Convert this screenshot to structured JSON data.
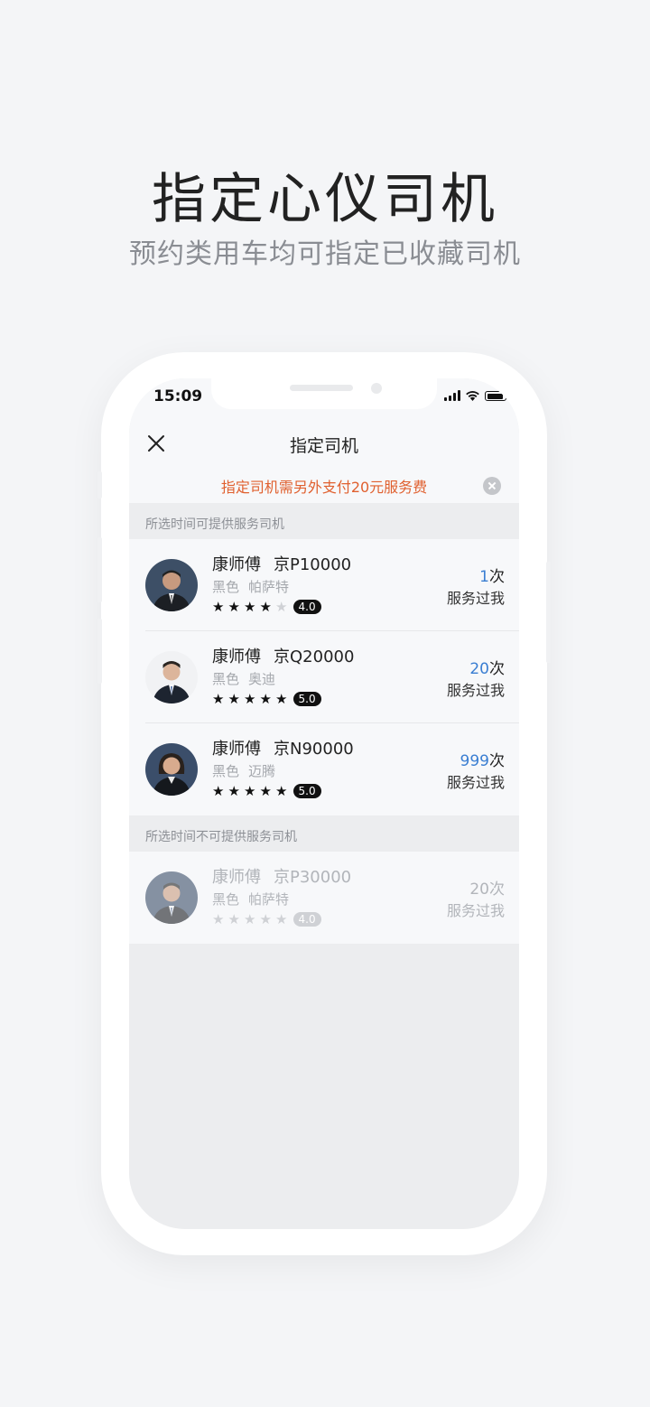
{
  "promo": {
    "title": "指定心仪司机",
    "subtitle": "预约类用车均可指定已收藏司机"
  },
  "status_bar": {
    "time": "15:09",
    "icons": [
      "signal-icon",
      "wifi-icon",
      "battery-icon"
    ]
  },
  "nav": {
    "title": "指定司机",
    "close_icon": "close-icon"
  },
  "notice": {
    "text": "指定司机需另外支付20元服务费",
    "close_icon": "close-circle-icon"
  },
  "sections": {
    "available_header": "所选时间可提供服务司机",
    "unavailable_header": "所选时间不可提供服务司机"
  },
  "drivers_available": [
    {
      "name": "康师傅",
      "plate": "京P10000",
      "color": "黑色",
      "model": "帕萨特",
      "stars": 4,
      "score": "4.0",
      "count": "1",
      "count_unit": "次",
      "served": "服务过我"
    },
    {
      "name": "康师傅",
      "plate": "京Q20000",
      "color": "黑色",
      "model": "奥迪",
      "stars": 5,
      "score": "5.0",
      "count": "20",
      "count_unit": "次",
      "served": "服务过我"
    },
    {
      "name": "康师傅",
      "plate": "京N90000",
      "color": "黑色",
      "model": "迈腾",
      "stars": 5,
      "score": "5.0",
      "count": "999",
      "count_unit": "次",
      "served": "服务过我"
    }
  ],
  "drivers_unavailable": [
    {
      "name": "康师傅",
      "plate": "京P30000",
      "color": "黑色",
      "model": "帕萨特",
      "stars": 5,
      "score": "4.0",
      "count": "20",
      "count_unit": "次",
      "served": "服务过我"
    }
  ],
  "colors": {
    "accent_blue": "#3a7ed2",
    "notice_orange": "#e0602f",
    "background": "#f4f5f7"
  }
}
